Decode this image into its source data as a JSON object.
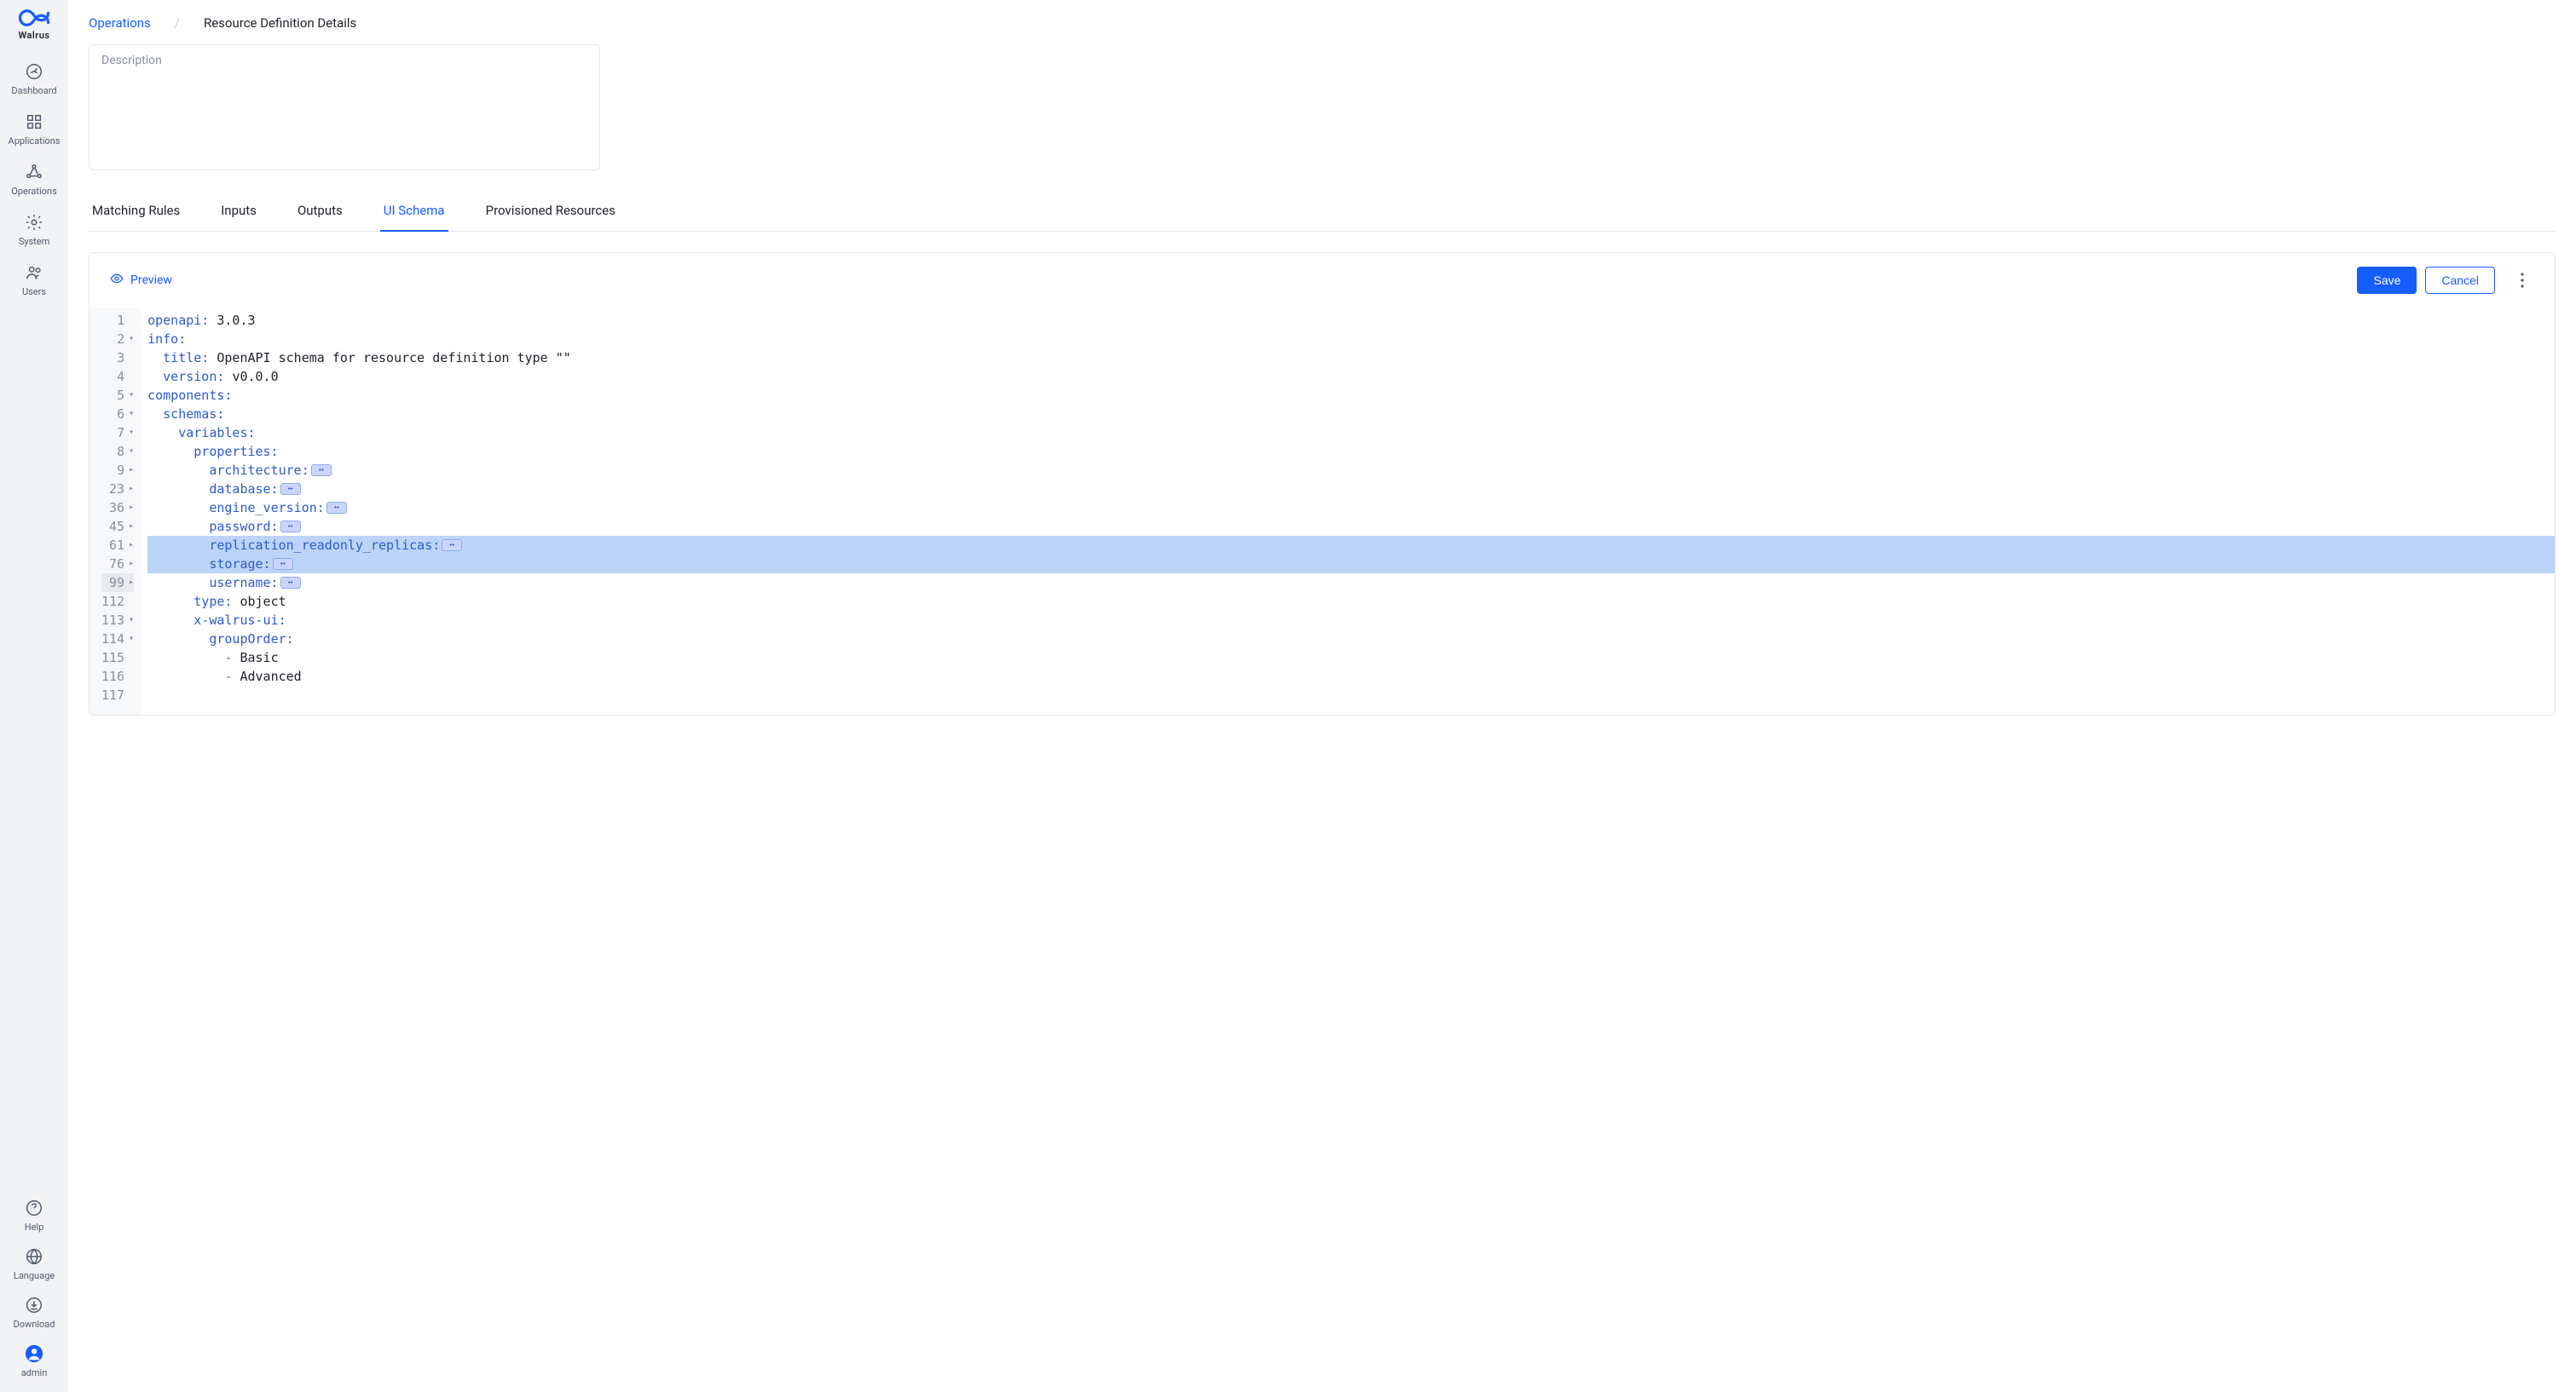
{
  "brand": "Walrus",
  "sidebar": {
    "main": [
      {
        "label": "Dashboard"
      },
      {
        "label": "Applications"
      },
      {
        "label": "Operations"
      },
      {
        "label": "System"
      },
      {
        "label": "Users"
      }
    ],
    "footer": [
      {
        "label": "Help"
      },
      {
        "label": "Language"
      },
      {
        "label": "Download"
      },
      {
        "label": "admin"
      }
    ]
  },
  "breadcrumb": {
    "link": "Operations",
    "sep": "/",
    "current": "Resource Definition Details"
  },
  "description_placeholder": "Description",
  "tabs": [
    {
      "label": "Matching Rules"
    },
    {
      "label": "Inputs"
    },
    {
      "label": "Outputs"
    },
    {
      "label": "UI Schema",
      "active": true
    },
    {
      "label": "Provisioned Resources"
    }
  ],
  "toolbar": {
    "preview": "Preview",
    "save": "Save",
    "cancel": "Cancel"
  },
  "editor": {
    "lines": [
      {
        "n": "1",
        "fold": "",
        "hl": false,
        "indent": 0,
        "key": "openapi",
        "val": "3.0.3"
      },
      {
        "n": "2",
        "fold": "▾",
        "hl": false,
        "indent": 0,
        "key": "info",
        "val": ""
      },
      {
        "n": "3",
        "fold": "",
        "hl": false,
        "indent": 1,
        "key": "title",
        "val": "OpenAPI schema for resource definition type \"\""
      },
      {
        "n": "4",
        "fold": "",
        "hl": false,
        "indent": 1,
        "key": "version",
        "val": "v0.0.0"
      },
      {
        "n": "5",
        "fold": "▾",
        "hl": false,
        "indent": 0,
        "key": "components",
        "val": ""
      },
      {
        "n": "6",
        "fold": "▾",
        "hl": false,
        "indent": 1,
        "key": "schemas",
        "val": ""
      },
      {
        "n": "7",
        "fold": "▾",
        "hl": false,
        "indent": 2,
        "key": "variables",
        "val": ""
      },
      {
        "n": "8",
        "fold": "▾",
        "hl": false,
        "indent": 3,
        "key": "properties",
        "val": ""
      },
      {
        "n": "9",
        "fold": "▸",
        "hl": false,
        "indent": 4,
        "key": "architecture",
        "folded": true
      },
      {
        "n": "23",
        "fold": "▸",
        "hl": false,
        "indent": 4,
        "key": "database",
        "folded": true
      },
      {
        "n": "36",
        "fold": "▸",
        "hl": false,
        "indent": 4,
        "key": "engine_version",
        "folded": true
      },
      {
        "n": "45",
        "fold": "▸",
        "hl": false,
        "indent": 4,
        "key": "password",
        "folded": true
      },
      {
        "n": "61",
        "fold": "▸",
        "hl": true,
        "indent": 4,
        "key": "replication_readonly_replicas",
        "folded": true
      },
      {
        "n": "76",
        "fold": "▸",
        "hl": true,
        "indent": 4,
        "key": "storage",
        "folded": true
      },
      {
        "n": "99",
        "fold": "▸",
        "hl": false,
        "ghl": true,
        "indent": 4,
        "key": "username",
        "folded": true
      },
      {
        "n": "112",
        "fold": "",
        "hl": false,
        "indent": 3,
        "key": "type",
        "val": "object"
      },
      {
        "n": "113",
        "fold": "▾",
        "hl": false,
        "indent": 3,
        "key": "x-walrus-ui",
        "val": ""
      },
      {
        "n": "114",
        "fold": "▾",
        "hl": false,
        "indent": 4,
        "key": "groupOrder",
        "val": ""
      },
      {
        "n": "115",
        "fold": "",
        "hl": false,
        "indent": 5,
        "dash": true,
        "val": "Basic"
      },
      {
        "n": "116",
        "fold": "",
        "hl": false,
        "indent": 5,
        "dash": true,
        "val": "Advanced"
      },
      {
        "n": "117",
        "fold": "",
        "hl": false,
        "indent": 0,
        "empty": true
      }
    ]
  }
}
